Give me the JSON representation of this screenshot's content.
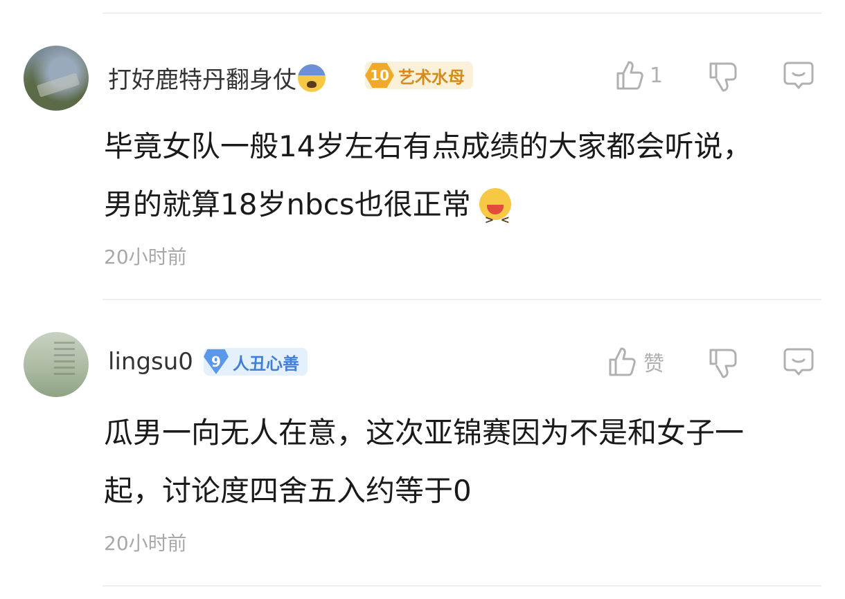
{
  "comments": [
    {
      "username": "打好鹿特丹翻身仗",
      "badge_level": "10",
      "badge_title": "艺术水母",
      "like_count": "1",
      "content_line1": "毕竟女队一般14岁左右有点成绩的大家都会听说，",
      "content_line2": "男的就算18岁nbcs也很正常",
      "time": "20小时前"
    },
    {
      "username": "lingsu0",
      "badge_level": "9",
      "badge_title": "人丑心善",
      "like_label": "赞",
      "content_line1": "瓜男一向无人在意，这次亚锦赛因为不是和女子一",
      "content_line2": "起，讨论度四舍五入约等于0",
      "time": "20小时前"
    }
  ],
  "colors": {
    "badge_gold": "#f0a928",
    "badge_blue": "#5b98ea",
    "meta_text": "#a8a8a8"
  }
}
